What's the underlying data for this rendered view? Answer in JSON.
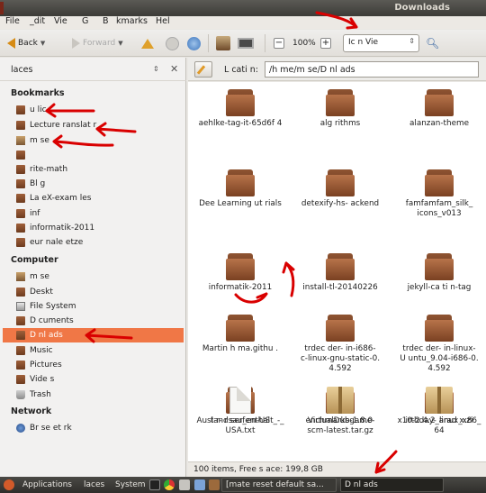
{
  "window": {
    "title": "Downloads"
  },
  "menu": [
    "File",
    "_dit",
    "Vie",
    "G",
    "B",
    "kmarks",
    "Hel"
  ],
  "toolbar": {
    "back_label": "Back",
    "forward_label": "Forward",
    "zoom_level": "100%",
    "view_mode": "Ic n Vie"
  },
  "sidebar": {
    "header": "laces",
    "sections": [
      {
        "title": "Bookmarks",
        "items": [
          "u lic",
          "Lecture ranslat r",
          "m se",
          "",
          "rite-math",
          "Bl g",
          "La eX-exam les",
          "inf",
          "informatik-2011",
          "eur nale etze"
        ]
      },
      {
        "title": "Computer",
        "items": [
          "m se",
          "Deskt",
          "File System",
          "D cuments",
          "D nl ads",
          "Music",
          "Pictures",
          "Vide s",
          "Trash"
        ]
      },
      {
        "title": "Network",
        "items": [
          "Br se et rk"
        ]
      }
    ],
    "selected": "D nl ads"
  },
  "location": {
    "label": "L cati n:",
    "path": "/h me/m se/D nl ads"
  },
  "files": [
    {
      "name": "aehlke-tag-it-65d6f 4",
      "type": "folder"
    },
    {
      "name": "alg rithms",
      "type": "folder"
    },
    {
      "name": "alanzan-theme",
      "type": "folder"
    },
    {
      "name": "Dee Learning ut rials",
      "type": "folder"
    },
    {
      "name": "detexify-hs- ackend",
      "type": "folder"
    },
    {
      "name": "famfamfam_silk_\nicons_v013",
      "type": "folder"
    },
    {
      "name": "informatik-2011",
      "type": "folder"
    },
    {
      "name": "install-tl-20140226",
      "type": "folder"
    },
    {
      "name": "jekyll-ca ti n-tag",
      "type": "folder"
    },
    {
      "name": "Martin h ma.githu .",
      "type": "folder"
    },
    {
      "name": "trdec der- in-i686-\nc-linux-gnu-static-0.\n4.592",
      "type": "folder"
    },
    {
      "name": "trdec der- in-linux-\nU untu_9.04-i686-0.\n4.592",
      "type": "folder"
    },
    {
      "name": "t r- r ser_en-US",
      "type": "folder"
    },
    {
      "name": "VirtualDub-1.8.0",
      "type": "folder"
    },
    {
      "name": "x10-2.4.2_linux_x86_\n64",
      "type": "folder"
    },
    {
      "name": "Auslandsaufenthalt_-_\nUSA.txt",
      "type": "text"
    },
    {
      "name": "enchmarksgame-\nscm-latest.tar.gz",
      "type": "archive"
    },
    {
      "name": "irthday- arad x.zi",
      "type": "archive"
    }
  ],
  "status": "100 items, Free s ace: 199,8 GB",
  "panel": {
    "applications": "Applications",
    "places": "laces",
    "system": "System",
    "tasks": [
      "[mate reset default sa...",
      "D nl ads"
    ]
  },
  "colors": {
    "selection": "#f07746",
    "annotation": "#d90000",
    "folder": "#7a4122"
  }
}
